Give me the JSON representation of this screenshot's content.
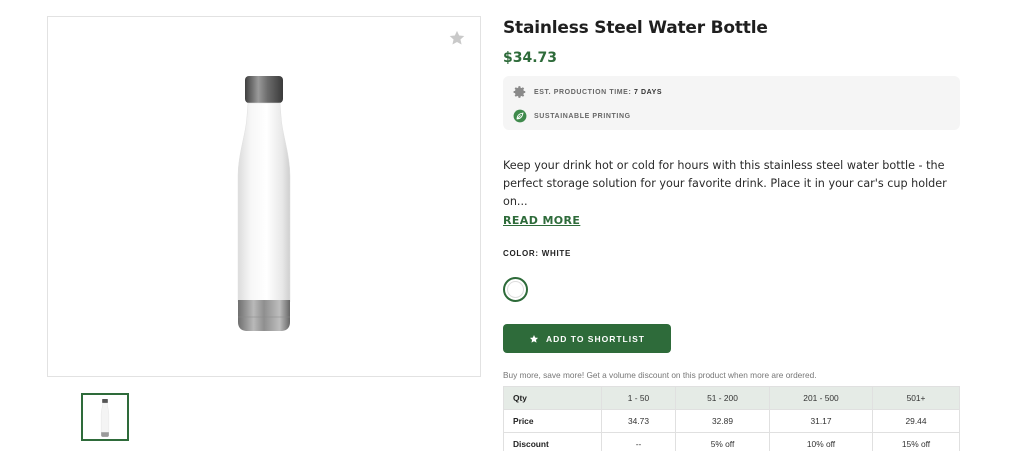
{
  "product": {
    "title": "Stainless Steel Water Bottle",
    "price": "$34.73",
    "perks": {
      "production_label": "EST. PRODUCTION TIME:",
      "production_value": "7 DAYS",
      "sustainable": "SUSTAINABLE PRINTING"
    },
    "description": "Keep your drink hot or cold for hours with this stainless steel water bottle - the perfect storage solution for your favorite drink. Place it in your car's cup holder on...",
    "read_more": "READ MORE",
    "color_label": "COLOR:",
    "color_value": "WHITE",
    "shortlist_button": "ADD TO SHORTLIST",
    "volume_note": "Buy more, save more! Get a volume discount on this product when more are ordered."
  },
  "volume_table": {
    "headers": [
      "Qty",
      "1 - 50",
      "51 - 200",
      "201 - 500",
      "501+"
    ],
    "rows": [
      [
        "Price",
        "34.73",
        "32.89",
        "31.17",
        "29.44"
      ],
      [
        "Discount",
        "--",
        "5% off",
        "10% off",
        "15% off"
      ]
    ]
  },
  "icons": {
    "favorite": "star-icon",
    "production": "gear-icon",
    "sustainable": "leaf-icon",
    "shortlist": "star-icon"
  },
  "colors": {
    "accent": "#2e6b3a",
    "table_header": "#e5ebe6",
    "perks_bg": "#f5f5f5"
  }
}
